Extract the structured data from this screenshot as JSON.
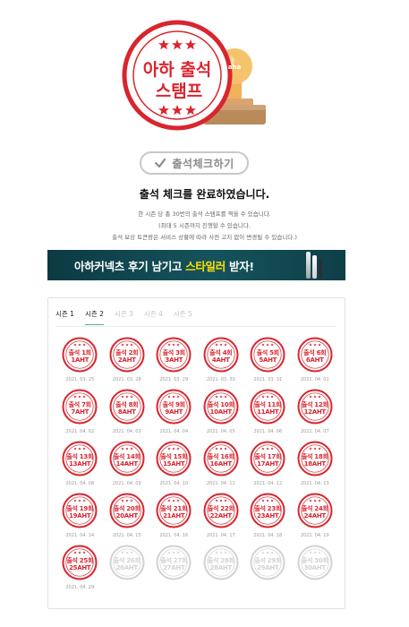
{
  "hero": {
    "title_line1": "아하 출석",
    "title_line2": "스탬프",
    "brand_mark": "aha",
    "stamp_color": "#d9252e"
  },
  "check_button": {
    "label": "출석체크하기",
    "icon": "check-icon"
  },
  "message": {
    "done": "출석 체크를 완료하였습니다."
  },
  "info": {
    "line1": "한 시즌 당 총 30번의 출석 스탬프를 찍을 수 있습니다.",
    "line2": "(최대 5 시즌까지 진행할 수 있습니다.",
    "line3": "출석 보상 토큰량은 서비스 상황에 따라 사전 고지 없이 변경될 수 있습니다.)"
  },
  "banner": {
    "text_before": "아하커넥츠 후기 남기고 ",
    "text_highlight": "스타일러",
    "text_after": " 받자!",
    "highlight_color": "#ffe100"
  },
  "tabs": [
    {
      "label": "시즌 1",
      "state": "active"
    },
    {
      "label": "시즌 2",
      "state": "current"
    },
    {
      "label": "시즌 3",
      "state": "disabled"
    },
    {
      "label": "시즌 4",
      "state": "disabled"
    },
    {
      "label": "시즌 5",
      "state": "disabled"
    }
  ],
  "stamps": [
    {
      "line1": "출석 1회",
      "line2": "1AHT",
      "date": "2021. 03. 25",
      "stamped": true
    },
    {
      "line1": "출석 2회",
      "line2": "2AHT",
      "date": "2021. 03. 28",
      "stamped": true
    },
    {
      "line1": "출석 3회",
      "line2": "3AHT",
      "date": "2021. 03. 29",
      "stamped": true
    },
    {
      "line1": "출석 4회",
      "line2": "4AHT",
      "date": "2021. 03. 30",
      "stamped": true
    },
    {
      "line1": "출석 5회",
      "line2": "5AHT",
      "date": "2021. 03. 31",
      "stamped": true
    },
    {
      "line1": "출석 6회",
      "line2": "6AHT",
      "date": "2021. 04. 01",
      "stamped": true
    },
    {
      "line1": "출석 7회",
      "line2": "7AHT",
      "date": "2021. 04. 02",
      "stamped": true
    },
    {
      "line1": "출석 8회",
      "line2": "8AHT",
      "date": "2021. 04. 03",
      "stamped": true
    },
    {
      "line1": "출석 9회",
      "line2": "9AHT",
      "date": "2021. 04. 04",
      "stamped": true
    },
    {
      "line1": "출석 10회",
      "line2": "10AHT",
      "date": "2021. 04. 05",
      "stamped": true
    },
    {
      "line1": "출석 11회",
      "line2": "11AHT",
      "date": "2021. 04. 06",
      "stamped": true
    },
    {
      "line1": "출석 12회",
      "line2": "12AHT",
      "date": "2021. 04. 07",
      "stamped": true
    },
    {
      "line1": "출석 13회",
      "line2": "13AHT",
      "date": "2021. 04. 08",
      "stamped": true
    },
    {
      "line1": "출석 14회",
      "line2": "14AHT",
      "date": "2021. 04. 09",
      "stamped": true
    },
    {
      "line1": "출석 15회",
      "line2": "15AHT",
      "date": "2021. 04. 10",
      "stamped": true
    },
    {
      "line1": "출석 16회",
      "line2": "16AHT",
      "date": "2021. 04. 11",
      "stamped": true
    },
    {
      "line1": "출석 17회",
      "line2": "17AHT",
      "date": "2021. 04. 12",
      "stamped": true
    },
    {
      "line1": "출석 18회",
      "line2": "18AHT",
      "date": "2021. 04. 13",
      "stamped": true
    },
    {
      "line1": "출석 19회",
      "line2": "19AHT",
      "date": "2021. 04. 14",
      "stamped": true
    },
    {
      "line1": "출석 20회",
      "line2": "20AHT",
      "date": "2021. 04. 15",
      "stamped": true
    },
    {
      "line1": "출석 21회",
      "line2": "21AHT",
      "date": "2021. 04. 16",
      "stamped": true
    },
    {
      "line1": "출석 22회",
      "line2": "22AHT",
      "date": "2021. 04. 17",
      "stamped": true
    },
    {
      "line1": "출석 23회",
      "line2": "23AHT",
      "date": "2021. 04. 18",
      "stamped": true
    },
    {
      "line1": "출석 24회",
      "line2": "24AHT",
      "date": "2021. 04. 19",
      "stamped": true
    },
    {
      "line1": "출석 25회",
      "line2": "25AHT",
      "date": "2021. 04. 29",
      "stamped": true
    },
    {
      "line1": "출석 26회",
      "line2": "26AHT",
      "date": "",
      "stamped": false
    },
    {
      "line1": "출석 27회",
      "line2": "27AHT",
      "date": "",
      "stamped": false
    },
    {
      "line1": "출석 28회",
      "line2": "28AHT",
      "date": "",
      "stamped": false
    },
    {
      "line1": "출석 29회",
      "line2": "29AHT",
      "date": "",
      "stamped": false
    },
    {
      "line1": "출석 30회",
      "line2": "30AHT",
      "date": "",
      "stamped": false
    }
  ]
}
